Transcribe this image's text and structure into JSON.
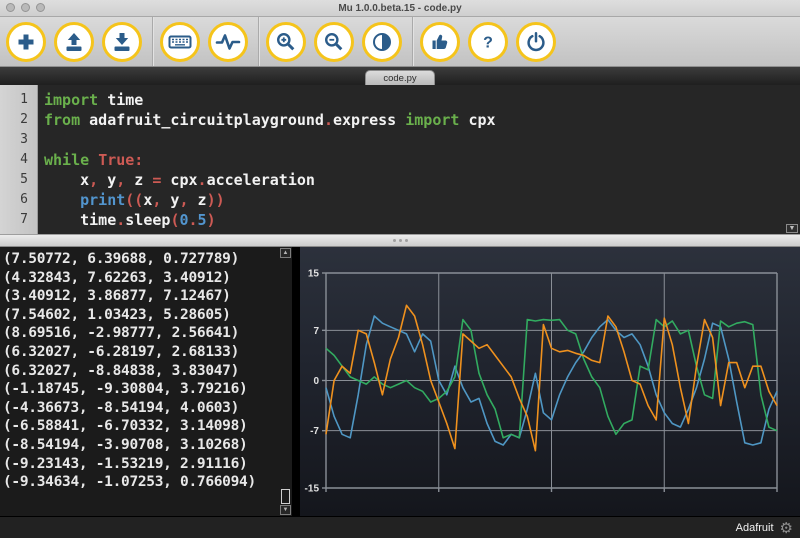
{
  "window": {
    "title": "Mu 1.0.0.beta.15 - code.py"
  },
  "titlebar": {
    "traffic_lights": [
      "close-button",
      "minimize-button",
      "zoom-button"
    ]
  },
  "toolbar": {
    "buttons": [
      {
        "name": "new",
        "icon": "plus-icon"
      },
      {
        "name": "load",
        "icon": "upload-icon"
      },
      {
        "name": "save",
        "icon": "download-icon"
      },
      {
        "name": "repl",
        "icon": "keyboard-icon"
      },
      {
        "name": "plotter",
        "icon": "pulse-icon"
      },
      {
        "name": "zoom-in",
        "icon": "zoom-in-icon"
      },
      {
        "name": "zoom-out",
        "icon": "zoom-out-icon"
      },
      {
        "name": "theme",
        "icon": "contrast-icon"
      },
      {
        "name": "check",
        "icon": "thumbs-up-icon"
      },
      {
        "name": "help",
        "icon": "question-icon"
      },
      {
        "name": "quit",
        "icon": "power-icon"
      }
    ],
    "separators_after_index": [
      2,
      4,
      7
    ]
  },
  "tabbar": {
    "tabs": [
      {
        "label": "code.py",
        "active": true
      }
    ]
  },
  "editor": {
    "lines": [
      {
        "num": 1,
        "segments": [
          {
            "t": "import",
            "c": "k"
          },
          {
            "t": " time",
            "c": "p"
          }
        ]
      },
      {
        "num": 2,
        "segments": [
          {
            "t": "from",
            "c": "k"
          },
          {
            "t": " adafruit_circuitplayground",
            "c": "p"
          },
          {
            "t": ".",
            "c": "r"
          },
          {
            "t": "express ",
            "c": "p"
          },
          {
            "t": "import",
            "c": "k"
          },
          {
            "t": " cpx",
            "c": "p"
          }
        ]
      },
      {
        "num": 3,
        "segments": []
      },
      {
        "num": 4,
        "segments": [
          {
            "t": "while ",
            "c": "k"
          },
          {
            "t": "True:",
            "c": "r"
          }
        ]
      },
      {
        "num": 5,
        "segments": [
          {
            "t": "    x",
            "c": "p"
          },
          {
            "t": ",",
            "c": "r"
          },
          {
            "t": " y",
            "c": "p"
          },
          {
            "t": ",",
            "c": "r"
          },
          {
            "t": " z ",
            "c": "p"
          },
          {
            "t": "=",
            "c": "r"
          },
          {
            "t": " cpx",
            "c": "p"
          },
          {
            "t": ".",
            "c": "r"
          },
          {
            "t": "acceleration",
            "c": "p"
          }
        ]
      },
      {
        "num": 6,
        "segments": [
          {
            "t": "    ",
            "c": "p"
          },
          {
            "t": "print",
            "c": "b"
          },
          {
            "t": "((",
            "c": "r"
          },
          {
            "t": "x",
            "c": "p"
          },
          {
            "t": ",",
            "c": "r"
          },
          {
            "t": " y",
            "c": "p"
          },
          {
            "t": ",",
            "c": "r"
          },
          {
            "t": " z",
            "c": "p"
          },
          {
            "t": "))",
            "c": "r"
          }
        ]
      },
      {
        "num": 7,
        "segments": [
          {
            "t": "    time",
            "c": "p"
          },
          {
            "t": ".",
            "c": "r"
          },
          {
            "t": "sleep",
            "c": "p"
          },
          {
            "t": "(",
            "c": "r"
          },
          {
            "t": "0",
            "c": "b"
          },
          {
            "t": ".",
            "c": "r"
          },
          {
            "t": "5",
            "c": "b"
          },
          {
            "t": ")",
            "c": "r"
          }
        ]
      }
    ],
    "syntax_colors": {
      "keyword": "#6ab04c",
      "punctuation": "#cd5a54",
      "builtin": "#5295ce",
      "plain": "#f2f2f2",
      "background": "#262626"
    }
  },
  "console": {
    "lines": [
      "(7.50772, 6.39688, 0.727789)",
      "(4.32843, 7.62263, 3.40912)",
      "(3.40912, 3.86877, 7.12467)",
      "(7.54602, 1.03423, 5.28605)",
      "(8.69516, -2.98777, 2.56641)",
      "(6.32027, -6.28197, 2.68133)",
      "(6.32027, -8.84838, 3.83047)",
      "(-1.18745, -9.30804, 3.79216)",
      "(-4.36673, -8.54194, 4.0603)",
      "(-6.58841, -6.70332, 3.14098)",
      "(-8.54194, -3.90708, 3.10268)",
      "(-9.23143, -1.53219, 2.91116)",
      "(-9.34634, -1.07253, 0.766094)"
    ]
  },
  "chart_data": {
    "type": "line",
    "title": "",
    "xlabel": "",
    "ylabel": "",
    "ylim": [
      -15,
      15
    ],
    "yticks": [
      15,
      7,
      0,
      -7,
      -15
    ],
    "x_unit": "samples at 0.5 s intervals",
    "grid": true,
    "legend": "none",
    "background": "#20242e",
    "grid_color": "#8a8f97",
    "series": [
      {
        "name": "blue",
        "color": "#4f97c4",
        "values": [
          -1,
          -5,
          -7.5,
          -8,
          -2,
          5,
          9,
          8,
          7.5,
          7,
          6.5,
          4,
          6.5,
          5.5,
          0,
          -2,
          2,
          -1,
          -3,
          -2.5,
          -6,
          -8.5,
          -9,
          -7.5,
          -8,
          -4,
          1,
          -4.5,
          -5.5,
          -2,
          0.5,
          2.5,
          4,
          6,
          7.5,
          8.5,
          7,
          6,
          6.5,
          5,
          2,
          -2,
          -4.5,
          -6,
          -6.5,
          -4,
          -1,
          3,
          8,
          7.5,
          3,
          -3,
          -8.7,
          -9,
          -8.7,
          -4,
          -1.5
        ]
      },
      {
        "name": "green",
        "color": "#32ab60",
        "values": [
          4.5,
          3.5,
          2,
          0.5,
          0,
          -0.5,
          0.5,
          -0.5,
          -1,
          -0.5,
          0,
          -1,
          -1.5,
          -3,
          -2.5,
          -1.5,
          0.5,
          8.5,
          7,
          1,
          -2,
          -4,
          -8,
          -7.5,
          -8,
          8.5,
          8.3,
          8.5,
          8.4,
          8.5,
          7,
          6.5,
          3,
          0.5,
          -1,
          -5,
          -7.5,
          -6,
          -5.5,
          2,
          1.5,
          8.5,
          7.5,
          8.3,
          6.5,
          7,
          2,
          -2,
          -2.5,
          8.3,
          7.5,
          8,
          8.2,
          7.8,
          -2,
          -6.5,
          -7
        ]
      },
      {
        "name": "orange",
        "color": "#ef911e",
        "values": [
          -7.5,
          0,
          2,
          1,
          7,
          6.5,
          2.5,
          -2,
          3,
          6,
          10.5,
          9,
          5,
          0,
          -3,
          -6,
          -9.5,
          6.5,
          5.5,
          4.5,
          5,
          3.5,
          2,
          0.5,
          -2.5,
          -5,
          -9.8,
          7.8,
          4.5,
          4,
          4.2,
          3.8,
          3.5,
          2.8,
          2.5,
          9,
          7.5,
          4,
          0,
          -0.5,
          -3.5,
          -5.5,
          8.7,
          5,
          -1,
          -6,
          2,
          8.5,
          6,
          -3.5,
          2.5,
          2.5,
          -1,
          2,
          2,
          -1.5,
          -3.5
        ]
      }
    ]
  },
  "statusbar": {
    "mode_label": "Adafruit",
    "gear": "gear-icon"
  },
  "colors": {
    "toolbar_ring": "#f5c41b",
    "toolbar_icon": "#2b5c8a",
    "accent_yellow": "#f5c41b"
  }
}
